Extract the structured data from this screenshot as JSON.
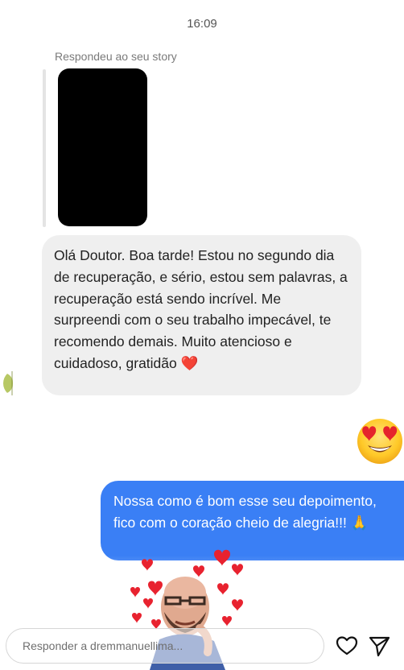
{
  "status_bar": {
    "time": "16:09"
  },
  "story_reply": {
    "label": "Respondeu ao seu story"
  },
  "messages": {
    "incoming": {
      "text": "Olá Doutor. Boa tarde! Estou no segundo dia de recuperação, e sério, estou sem palavras, a recuperação está sendo incrível. Me surpreendi com o seu trabalho impecável, te recomendo demais. Muito atencioso e cuidadoso, gratidão",
      "emoji": "❤️"
    },
    "reaction_emoji": "heart-eyes",
    "outgoing": {
      "text": "Nossa como é bom esse seu depoimento, fico com o coração cheio de alegria!!!",
      "emoji": "🙏"
    }
  },
  "sticker": {
    "description_icon": "avatar-hearts-sticker"
  },
  "reply": {
    "placeholder": "Responder a dremmanuellima..."
  },
  "icons": {
    "like": "heart-outline-icon",
    "send": "paper-plane-icon"
  },
  "colors": {
    "incoming_bubble": "#efefef",
    "outgoing_bubble": "#3a7ff5",
    "heart": "#e0262b"
  }
}
